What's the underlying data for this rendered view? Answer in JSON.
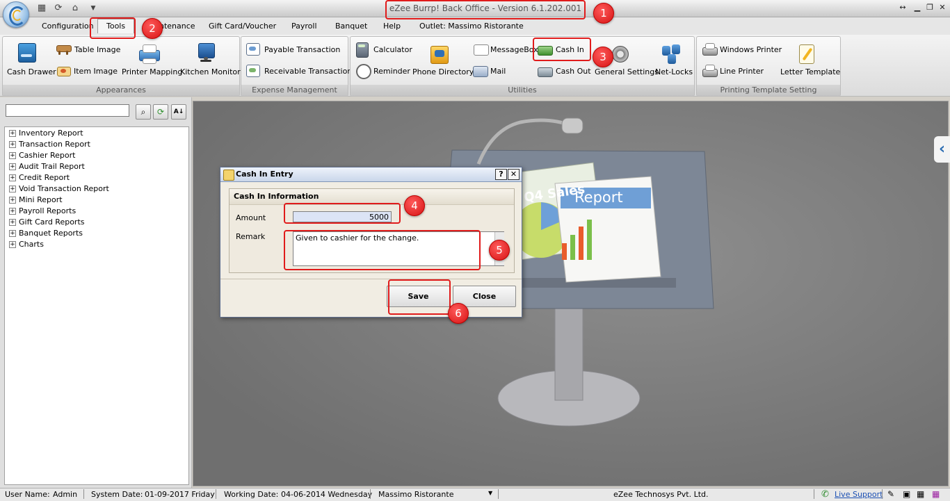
{
  "window": {
    "title": "eZee Burrp! Back Office - Version 6.1.202.001"
  },
  "menu": {
    "items": [
      "Configuration",
      "Tools",
      "Maintenance",
      "Gift Card/Voucher",
      "Payroll",
      "Banquet",
      "Help",
      "Outlet: Massimo Ristorante"
    ],
    "visible_text": [
      "Configuration",
      "Tools",
      "ntenance",
      "Gift Card/Voucher",
      "Payroll",
      "Banquet",
      "Help",
      "Outlet: Massimo Ristorante"
    ]
  },
  "ribbon": {
    "appearances": {
      "label": "Appearances",
      "cash_drawer": "Cash Drawer",
      "table_image": "Table Image",
      "item_image": "Item Image",
      "printer_mapping": "Printer Mapping",
      "kitchen_monitor": "Kitchen Monitor"
    },
    "expense": {
      "label": "Expense Management",
      "payable": "Payable Transaction",
      "receivable": "Receivable Transaction"
    },
    "utilities": {
      "label": "Utilities",
      "calculator": "Calculator",
      "reminder": "Reminder",
      "phone_directory": "Phone Directory",
      "messagebox": "MessageBox",
      "mail": "Mail",
      "cash_in": "Cash In",
      "cash_out": "Cash Out",
      "general_settings": "General Settings",
      "net_locks": "Net-Locks"
    },
    "printing": {
      "label": "Printing Template Setting",
      "windows_printer": "Windows Printer",
      "line_printer": "Line Printer",
      "letter_template": "Letter Template"
    }
  },
  "left_pane": {
    "search": {
      "value": "",
      "placeholder": ""
    },
    "tree": [
      "Inventory Report",
      "Transaction Report",
      "Cashier Report",
      "Audit Trail Report",
      "Credit Report",
      "Void Transaction Report",
      "Mini Report",
      "Payroll Reports",
      "Gift Card Reports",
      "Banquet Reports",
      "Charts"
    ]
  },
  "dialog": {
    "title": "Cash In Entry",
    "help": "?",
    "close_x": "✕",
    "section": "Cash In Information",
    "amount_label": "Amount",
    "amount_value": "5000",
    "remark_label": "Remark",
    "remark_value": "Given to cashier for the change.",
    "save": "Save",
    "close": "Close"
  },
  "illustration": {
    "report_title": "Report",
    "q4_sales": "Q4 Sales"
  },
  "annotations": [
    "1",
    "2",
    "3",
    "4",
    "5",
    "6"
  ],
  "status": {
    "user_label": "User Name:",
    "user": "Admin",
    "system_date_label": "System Date:",
    "system_date": "01-09-2017 Friday",
    "working_date_label": "Working Date:",
    "working_date": "04-06-2014 Wednesday",
    "outlet": "Massimo Ristorante",
    "company": "eZee Technosys Pvt. Ltd.",
    "live_support": "Live Support"
  },
  "colors": {
    "annotation_red": "#e01b1b",
    "link_blue": "#1a4fb3"
  }
}
